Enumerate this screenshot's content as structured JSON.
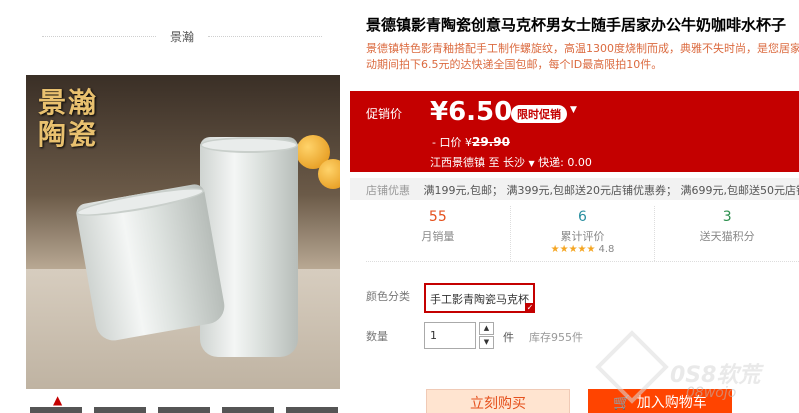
{
  "shop": {
    "name": "景瀚"
  },
  "gallery": {
    "brand_mark": "景瀚陶瓷"
  },
  "product": {
    "title": "景德镇影青陶瓷创意马克杯男女士随手居家办公牛奶咖啡水杯子",
    "subtitle_line1": "景德镇特色影青釉搭配手工制作螺旋纹，高温1300度烧制而成，典雅不失时尚，是您居家办公",
    "subtitle_line2": "动期间拍下6.5元的达快递全国包邮，每个ID最高限拍10件。"
  },
  "promo": {
    "label": "促销价",
    "price": "¥6.50",
    "tag": "限时促销",
    "orig_label": "- 口价 ¥",
    "orig_price": "29.90",
    "ship_from": "江西景德镇",
    "ship_to_word": "至",
    "ship_dest": "长沙",
    "ship_fee_label": "快递:",
    "ship_fee": "0.00",
    "accent": "#c40000"
  },
  "coupons": {
    "label": "店铺优惠",
    "text": "满199元,包邮；  满399元,包邮送20元店铺优惠券；  满699元,包邮送50元店铺优惠"
  },
  "stats": [
    {
      "value": "55",
      "label": "月销量"
    },
    {
      "value": "6",
      "label": "累计评价",
      "rating": "★★★★★",
      "score": "4.8"
    },
    {
      "value": "3",
      "label": "送天猫积分"
    }
  ],
  "sku": {
    "label": "颜色分类",
    "selected": "手工影青陶瓷马克杯"
  },
  "quantity": {
    "label": "数量",
    "value": "1",
    "unit": "件",
    "stock": "库存955件"
  },
  "actions": {
    "buy": "立刻购买",
    "cart": "加入购物车"
  },
  "watermark": {
    "text": "0S8软荒",
    "sub": "08wojo"
  }
}
